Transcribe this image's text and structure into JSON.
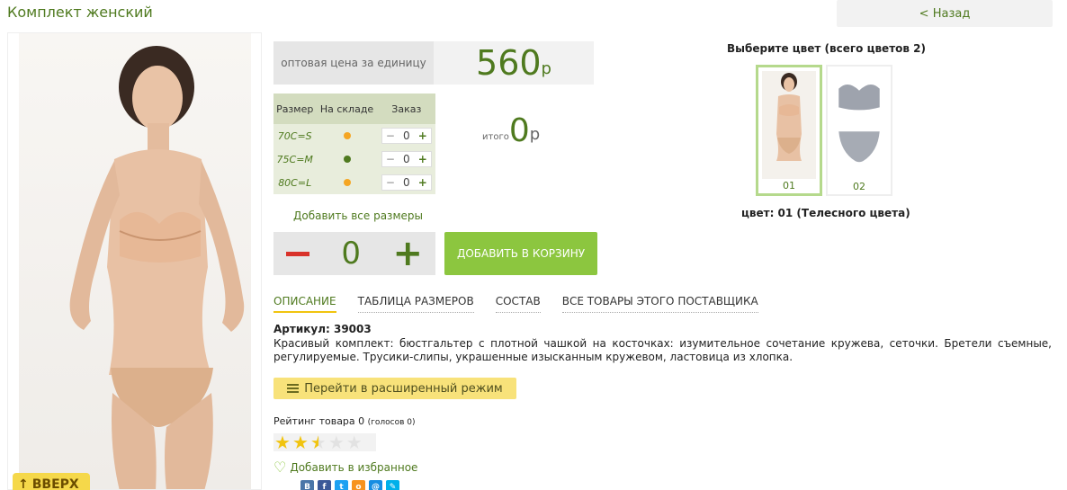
{
  "page": {
    "title": "Комплект женский",
    "back_label": "< Назад"
  },
  "photo": {
    "up_button": "ВВЕРХ"
  },
  "price": {
    "label": "оптовая цена за единицу",
    "value": "560",
    "currency": "р"
  },
  "sizes_table": {
    "headers": [
      "Размер",
      "На складе",
      "Заказ"
    ],
    "rows": [
      {
        "size": "70C=S",
        "stock_color": "#f5a623",
        "qty": "0"
      },
      {
        "size": "75C=M",
        "stock_color": "#4f7a1f",
        "qty": "0"
      },
      {
        "size": "80C=L",
        "stock_color": "#f5a623",
        "qty": "0"
      }
    ]
  },
  "stepper_symbols": {
    "minus": "−",
    "plus": "+"
  },
  "total": {
    "label": "итого",
    "value": "0",
    "currency": "р"
  },
  "add_all_sizes": "Добавить все размеры",
  "order": {
    "qty": "0",
    "add_to_cart": "ДОБАВИТЬ В КОРЗИНУ"
  },
  "tabs": [
    {
      "label": "ОПИСАНИЕ",
      "active": true
    },
    {
      "label": "ТАБЛИЦА РАЗМЕРОВ",
      "active": false
    },
    {
      "label": "СОСТАВ",
      "active": false
    },
    {
      "label": "ВСЕ ТОВАРЫ ЭТОГО ПОСТАВЩИКА",
      "active": false
    }
  ],
  "description": {
    "article": "Артикул: 39003",
    "text": "Красивый комплект: бюстгальтер с плотной чашкой на косточках: изумительное сочетание кружева, сеточки. Бретели съемные, регулируемые. Трусики-слипы, украшенные изысканным кружевом, ластовица из хлопка."
  },
  "extended_mode": "Перейти в расширенный режим",
  "rating": {
    "label": "Рейтинг товара 0",
    "votes": "(голосов 0)",
    "stars_filled": 2.5,
    "stars_total": 5
  },
  "favorite": "Добавить в избранное",
  "social": [
    {
      "icon": "vk-icon",
      "glyph": "B",
      "color": "#4a76a8"
    },
    {
      "icon": "facebook-icon",
      "glyph": "f",
      "color": "#3b5998"
    },
    {
      "icon": "twitter-icon",
      "glyph": "t",
      "color": "#1da1f2"
    },
    {
      "icon": "odnoklassniki-icon",
      "glyph": "o",
      "color": "#f7931e"
    },
    {
      "icon": "mailru-icon",
      "glyph": "@",
      "color": "#168de2"
    },
    {
      "icon": "livejournal-icon",
      "glyph": "✎",
      "color": "#00b0ea"
    }
  ],
  "colors": {
    "title": "Выберите цвет (всего цветов 2)",
    "options": [
      {
        "num": "01",
        "selected": true
      },
      {
        "num": "02",
        "selected": false
      }
    ],
    "selected_label": "цвет: 01 (Телесного цвета)"
  },
  "accent_colors": {
    "brand_green": "#4f7a1f",
    "button_green": "#8cc63f",
    "yellow": "#f8e27a"
  }
}
